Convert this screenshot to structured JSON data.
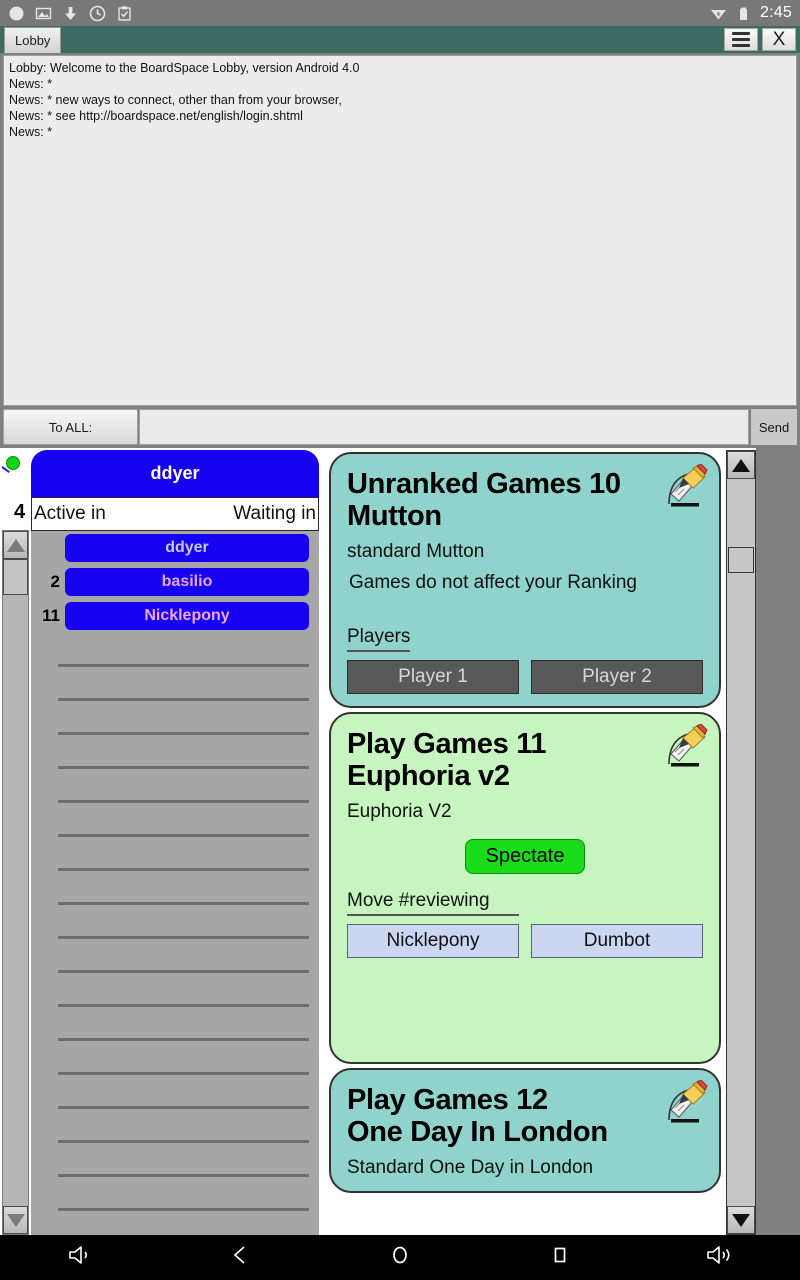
{
  "status_bar": {
    "icons": [
      "circle-icon",
      "image-icon",
      "download-icon",
      "clock-icon",
      "clipboard-check-icon"
    ],
    "wifi_icon": "wifi-icon",
    "battery_icon": "battery-icon",
    "clock": "2:45"
  },
  "title_bar": {
    "tab_label": "Lobby",
    "menu_icon": "hamburger-menu-icon",
    "close_label": "X",
    "background": "#3d6b63"
  },
  "chat": {
    "lines": [
      "Lobby: Welcome to the BoardSpace Lobby, version Android 4.0",
      "News: *",
      "News: * new ways to connect, other than from your browser,",
      "News: * see http://boardspace.net/english/login.shtml",
      "News: *"
    ]
  },
  "compose": {
    "to_label": "To ALL:",
    "input_value": "",
    "input_placeholder": "",
    "send_label": "Send"
  },
  "player_panel": {
    "status_dot_color": "#13d413",
    "active_count": "4",
    "header_name": "ddyer",
    "col_active": "Active in",
    "col_waiting": "Waiting in",
    "rows": [
      {
        "rank": "",
        "name": "ddyer",
        "name_color": "#c8c8ff"
      },
      {
        "rank": "2",
        "name": "basilio",
        "name_color": "#e8a8f0"
      },
      {
        "rank": "11",
        "name": "Nicklepony",
        "name_color": "#f0a8e8"
      }
    ],
    "empty_row_count": 17
  },
  "games": [
    {
      "theme": "teal",
      "title_line1": "Unranked Games 10",
      "title_line2": "Mutton",
      "subtitle": "standard Mutton",
      "note": "Games do not affect your Ranking",
      "section_label": "Players",
      "icon": "pencil-notepad-icon",
      "seats": [
        {
          "label": "Player 1",
          "style": "dark"
        },
        {
          "label": "Player 2",
          "style": "dark"
        }
      ]
    },
    {
      "theme": "green",
      "title_line1": "Play Games 11",
      "title_line2": "Euphoria v2",
      "subtitle": "Euphoria V2",
      "note": "",
      "spectate_label": "Spectate",
      "section_label": "Move #reviewing",
      "icon": "pencil-notepad-icon",
      "seats": [
        {
          "label": "Nicklepony",
          "style": "light"
        },
        {
          "label": "Dumbot",
          "style": "light"
        }
      ]
    },
    {
      "theme": "teal",
      "title_line1": "Play Games 12",
      "title_line2": "One Day In London",
      "subtitle": "Standard One Day in London",
      "note": "",
      "section_label": "",
      "icon": "pencil-notepad-icon",
      "seats": []
    }
  ],
  "scrollbars": {
    "left_up_icon": "triangle-up-icon",
    "left_down_icon": "triangle-down-icon",
    "right_up_icon": "triangle-up-icon",
    "right_down_icon": "triangle-down-icon"
  },
  "navbar": {
    "items": [
      "volume-down-icon",
      "back-icon",
      "home-icon",
      "recents-icon",
      "volume-up-icon"
    ]
  }
}
